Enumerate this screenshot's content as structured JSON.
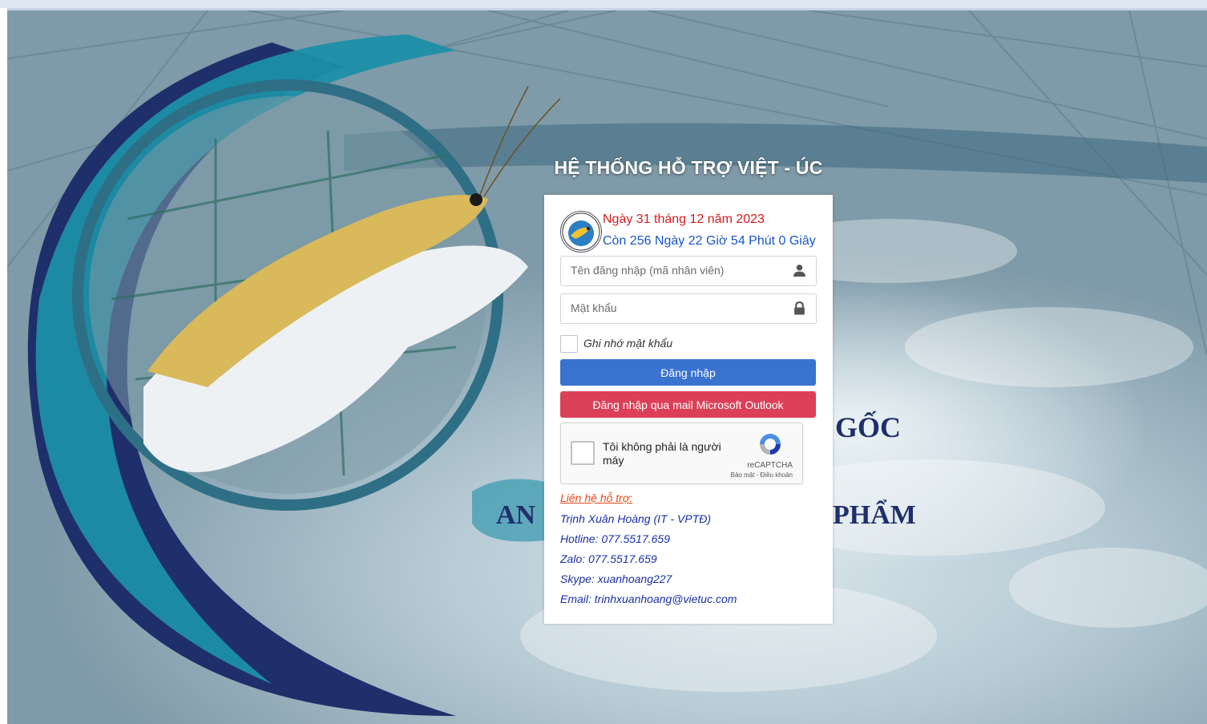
{
  "page": {
    "title": "HỆ THỐNG HỖ TRỢ VIỆT - ÚC",
    "background_text": {
      "word_right": "GỐC",
      "word_left": "AN",
      "word_bottom_right": "PHẨM"
    }
  },
  "login": {
    "date_text": "Ngày 31 tháng 12 năm 2023",
    "countdown_text": "Còn 256 Ngày 22 Giờ 54 Phút 0 Giây",
    "username_placeholder": "Tên đăng nhập (mã nhân viên)",
    "password_placeholder": "Mật khẩu",
    "remember_label": "Ghi nhớ mật khẩu",
    "login_button": "Đăng nhập",
    "outlook_button": "Đăng nhập qua mail Microsoft Outlook"
  },
  "recaptcha": {
    "label": "Tôi không phải là người máy",
    "brand": "reCAPTCHA",
    "terms": "Bảo mật - Điều khoản"
  },
  "support": {
    "title": "Liên hệ hỗ trợ:",
    "lines": [
      "Trịnh Xuân Hoàng (IT - VPTĐ)",
      "Hotline: 077.5517.659",
      "Zalo: 077.5517.659",
      "Skype: xuanhoang227",
      "Email: trinhxuanhoang@vietuc.com"
    ]
  },
  "colors": {
    "date": "#d41b1b",
    "countdown": "#1a56c9",
    "login_button": "#3a72d0",
    "outlook_button": "#dc4058",
    "support_title": "#e5491b",
    "support_text": "#1a2fa8",
    "brand_dark_blue": "#1f2f6b",
    "brand_teal": "#1e8fa8"
  }
}
